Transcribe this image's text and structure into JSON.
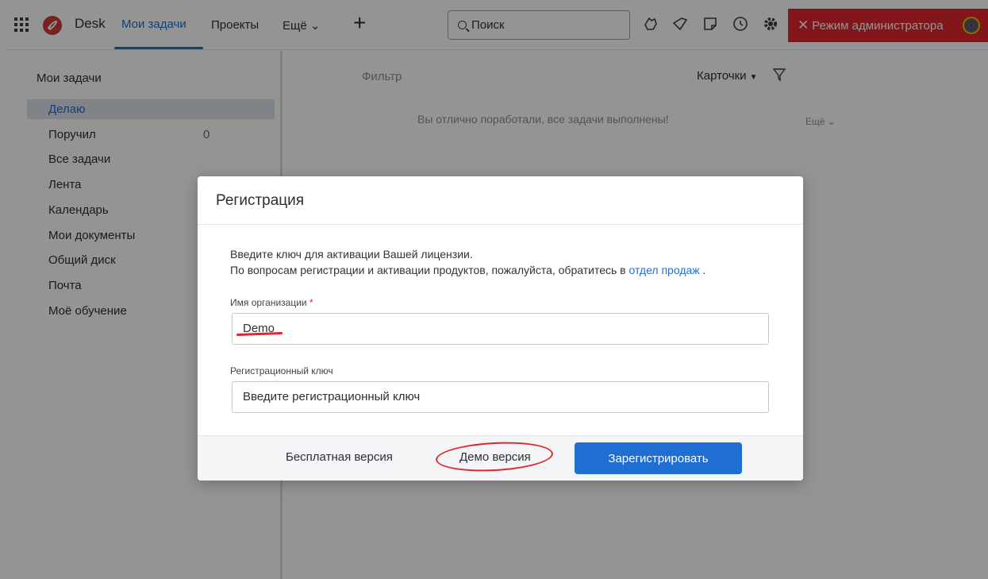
{
  "header": {
    "brand": "Desk",
    "nav": {
      "active": "Мои задачи",
      "projects": "Проекты",
      "more": "Ещё ⌄"
    },
    "search_placeholder": "Поиск",
    "admin_mode": "Режим администратора",
    "icons": [
      "apps-grid-icon",
      "rocket-logo-icon",
      "plus-icon",
      "search-icon",
      "hand-icon",
      "tag-icon",
      "note-icon",
      "history-icon",
      "gear-icon",
      "close-icon",
      "avatar"
    ]
  },
  "sidebar": {
    "title": "Мои задачи",
    "items": [
      {
        "label": "Делаю",
        "active": true
      },
      {
        "label": "Поручил",
        "count": "0"
      },
      {
        "label": "Все задачи"
      },
      {
        "label": "Лента"
      },
      {
        "label": "Календарь"
      },
      {
        "label": "Мои документы"
      },
      {
        "label": "Общий диск"
      },
      {
        "label": "Почта"
      },
      {
        "label": "Моё обучение"
      }
    ]
  },
  "main": {
    "filter": "Фильтр",
    "view": "Карточки",
    "empty_message": "Вы отлично поработали, все задачи выполнены!",
    "more": "Ещё ⌄"
  },
  "modal": {
    "title": "Регистрация",
    "intro_line1": "Введите ключ для активации Вашей лицензии.",
    "intro_line2_prefix": "По вопросам регистрации и активации продуктов, пожалуйста, обратитесь в",
    "intro_link": "отдел продаж",
    "intro_suffix": " .",
    "org_label": "Имя организации",
    "org_required": "*",
    "org_value": "Demo",
    "key_label": "Регистрационный ключ",
    "key_placeholder": "Введите регистрационный ключ",
    "free_button": "Бесплатная версия",
    "demo_button": "Демо версия",
    "register_button": "Зарегистрировать"
  },
  "colors": {
    "accent": "#1f6ed4",
    "admin_red": "#e2262d",
    "annotation_red": "#e2262d"
  }
}
